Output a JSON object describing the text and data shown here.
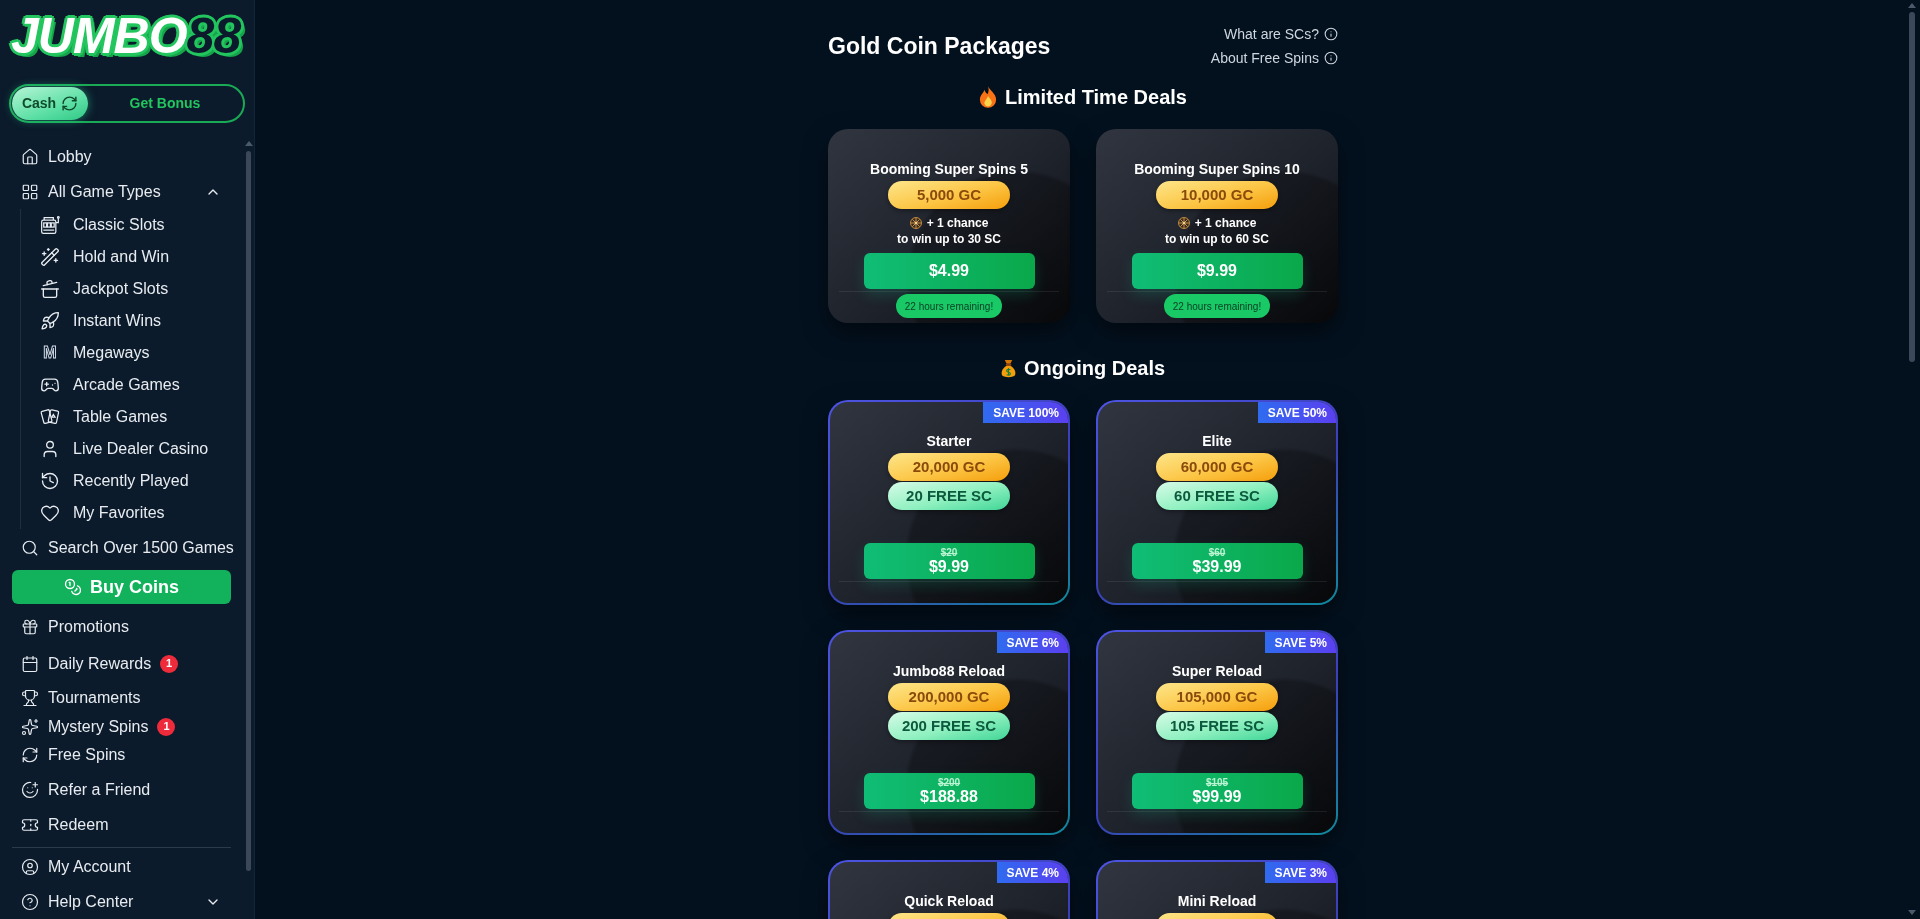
{
  "sidebar": {
    "logo": {
      "word": "JUMBO",
      "number": "88"
    },
    "balance_tabs": [
      {
        "label": "Cash",
        "selected": true
      },
      {
        "label": "Get Bonus",
        "selected": false
      }
    ],
    "nav": [
      {
        "label": "Lobby"
      },
      {
        "label": "All Game Types",
        "expanded": true,
        "children": [
          {
            "label": "Classic Slots"
          },
          {
            "label": "Hold and Win"
          },
          {
            "label": "Jackpot Slots"
          },
          {
            "label": "Instant Wins"
          },
          {
            "label": "Megaways",
            "icon_text": "M"
          },
          {
            "label": "Arcade Games"
          },
          {
            "label": "Table Games"
          },
          {
            "label": "Live Dealer Casino"
          },
          {
            "label": "Recently Played"
          },
          {
            "label": "My Favorites"
          }
        ]
      },
      {
        "label": "Search Over 1500 Games"
      }
    ],
    "buy_button": "Buy Coins",
    "menu": [
      {
        "label": "Promotions"
      },
      {
        "label": "Daily Rewards",
        "badge": "1"
      },
      {
        "label": "Tournaments"
      },
      {
        "label": "Mystery Spins",
        "badge": "1"
      },
      {
        "label": "Free Spins"
      },
      {
        "label": "Refer a Friend"
      },
      {
        "label": "Redeem"
      }
    ],
    "account_menu": [
      {
        "label": "My Account"
      },
      {
        "label": "Help Center",
        "expanded": false
      }
    ]
  },
  "main": {
    "title": "Gold Coin Packages",
    "help_links": [
      "What are SCs?",
      "About Free Spins"
    ],
    "sections": [
      {
        "title": "Limited Time Deals",
        "kind": "limited",
        "packages": [
          {
            "name": "Booming Super Spins 5",
            "gold": "5,000 GC",
            "chance": "+ 1 chance",
            "chance_detail": "to win up to 30 SC",
            "price": "$4.99",
            "timer": "22 hours remaining!"
          },
          {
            "name": "Booming Super Spins 10",
            "gold": "10,000 GC",
            "chance": "+ 1 chance",
            "chance_detail": "to win up to 60 SC",
            "price": "$9.99",
            "timer": "22 hours remaining!"
          }
        ]
      },
      {
        "title": "Ongoing Deals",
        "kind": "ongoing",
        "packages": [
          {
            "badge": "SAVE 100%",
            "name": "Starter",
            "gold": "20,000 GC",
            "sweeps": "20 FREE SC",
            "old_price": "$20",
            "price": "$9.99"
          },
          {
            "badge": "SAVE 50%",
            "name": "Elite",
            "gold": "60,000 GC",
            "sweeps": "60 FREE SC",
            "old_price": "$60",
            "price": "$39.99"
          },
          {
            "badge": "SAVE 6%",
            "name": "Jumbo88 Reload",
            "gold": "200,000 GC",
            "sweeps": "200 FREE SC",
            "old_price": "$200",
            "price": "$188.88"
          },
          {
            "badge": "SAVE 5%",
            "name": "Super Reload",
            "gold": "105,000 GC",
            "sweeps": "105 FREE SC",
            "old_price": "$105",
            "price": "$99.99"
          },
          {
            "badge": "SAVE 4%",
            "name": "Quick Reload"
          },
          {
            "badge": "SAVE 3%",
            "name": "Mini Reload"
          }
        ]
      }
    ]
  }
}
